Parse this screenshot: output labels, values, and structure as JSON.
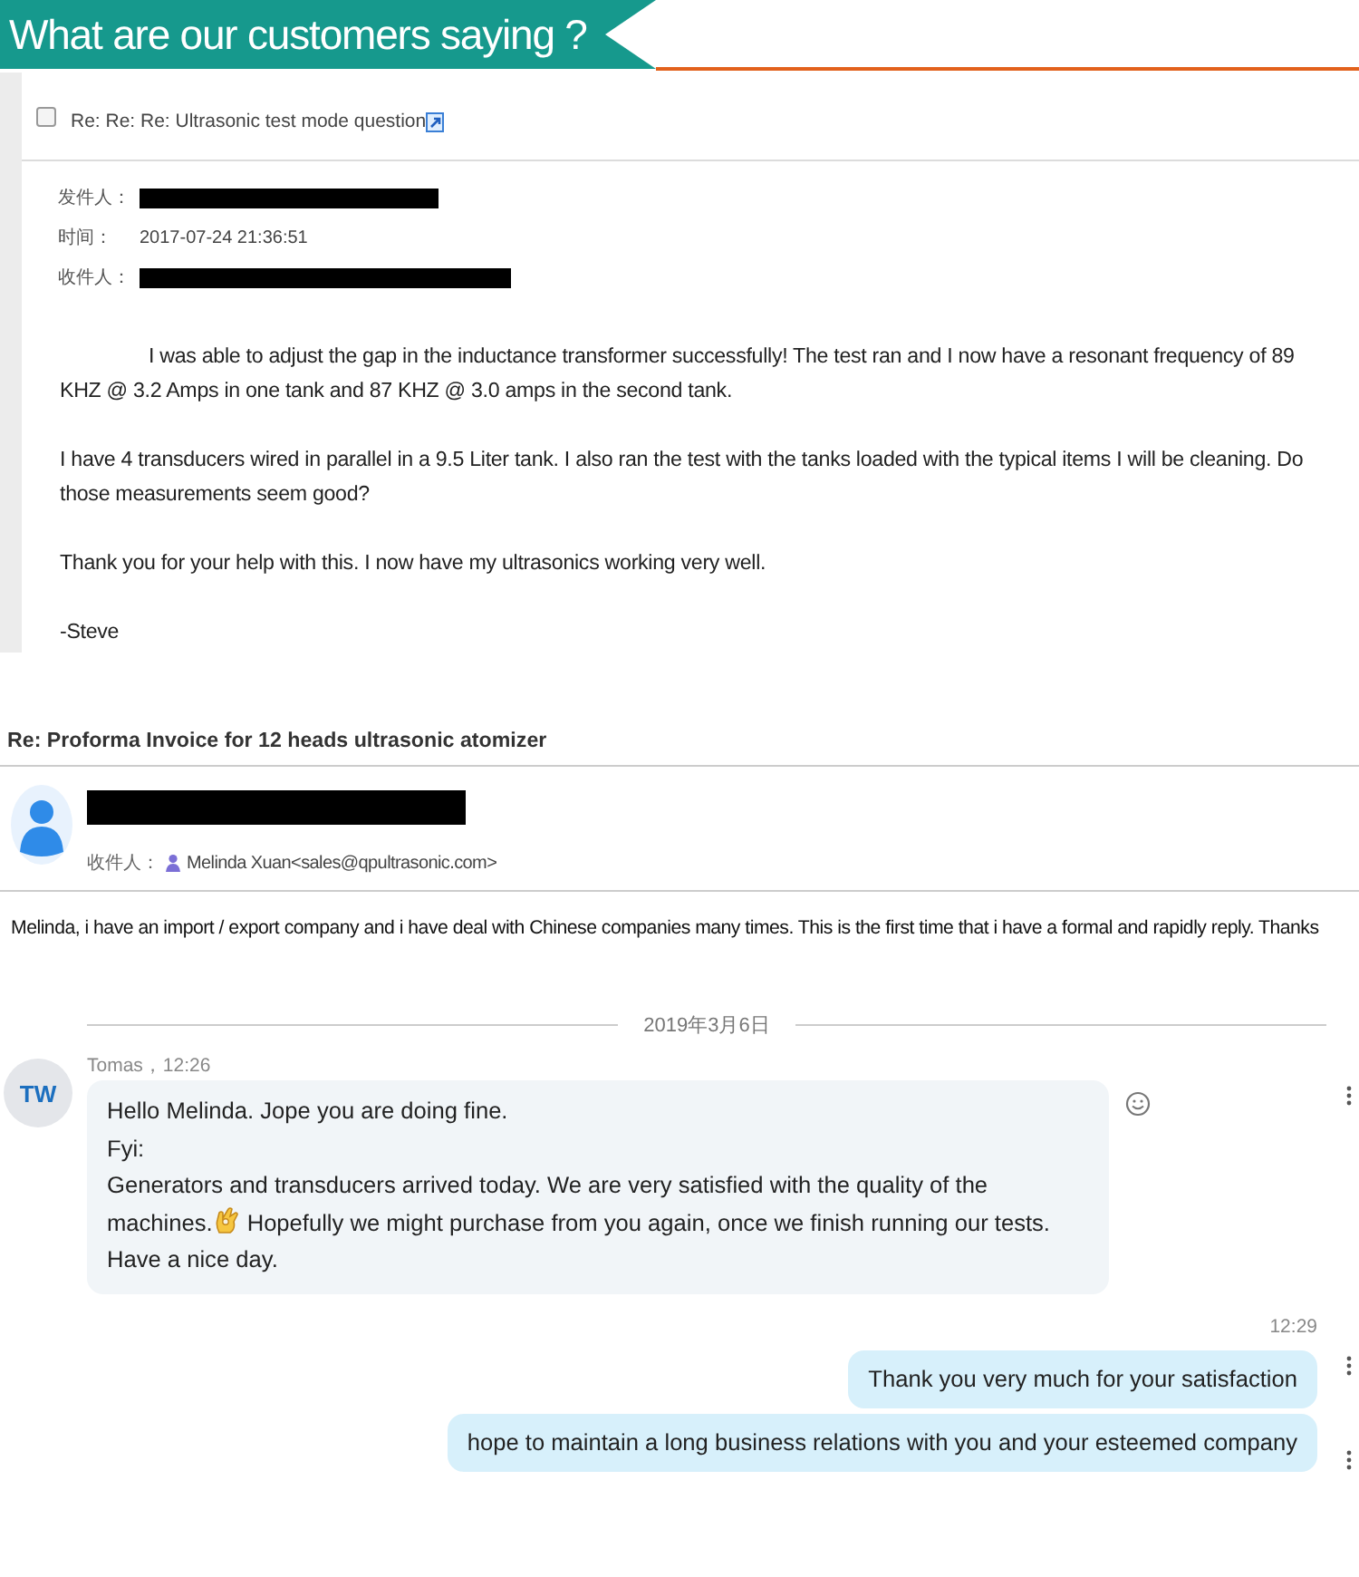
{
  "banner": {
    "title": "What are our customers saying ?"
  },
  "email_1": {
    "subject": "Re: Re: Re: Ultrasonic test mode question",
    "checked": false,
    "fields": [
      {
        "label": "发件人：",
        "redacted": true
      },
      {
        "label": "时间：",
        "redacted": false,
        "value": "2017-07-24 21:36:51"
      },
      {
        "label": "收件人：",
        "redacted": true
      }
    ],
    "paragraphs": [
      {
        "indent": true,
        "text": "I was able to adjust the gap in the inductance transformer successfully! The test ran and I now have a resonant frequency of 89 KHZ @ 3.2 Amps in one tank and 87 KHZ @ 3.0 amps in the second tank."
      },
      {
        "indent": false,
        "text": "I have 4 transducers wired in parallel in a 9.5 Liter tank. I also ran the test with the tanks loaded with the typical items I will be cleaning. Do those measurements seem good?"
      },
      {
        "indent": false,
        "text": "Thank you for your help with this. I now have my ultrasonics working very well."
      },
      {
        "indent": false,
        "text": "-Steve"
      }
    ]
  },
  "email_2": {
    "subject": "Re: Proforma Invoice for 12 heads ultrasonic atomizer",
    "sender_redacted": true,
    "recipient_label": "收件人：",
    "recipient": "Melinda Xuan<sales@qpultrasonic.com>",
    "body": "Melinda, i have an import / export company and i have deal with Chinese companies many times. This is the first time that i have a formal and rapidly reply. Thanks"
  },
  "chat": {
    "date": "2019年3月6日",
    "messages": [
      {
        "kind": "incoming",
        "avatar": "TW",
        "author": "Tomas，12:26",
        "lines": [
          {
            "text": "Hello Melinda. Jope you are doing fine.",
            "emoji": false
          },
          {
            "text": "Fyi:",
            "emoji": false
          },
          {
            "text": "Generators and transducers arrived today. We are very satisfied with the quality of the",
            "emoji": false
          },
          {
            "text": "machines.",
            "emoji": true,
            "after": "Hopefully we might purchase from you again, once we finish running our tests."
          },
          {
            "text": "Have a nice day.",
            "emoji": false
          }
        ]
      },
      {
        "kind": "outgoing",
        "time": "12:29",
        "text": "Thank you very much for your satisfaction"
      },
      {
        "kind": "outgoing",
        "text": "hope to maintain a long business relations with you and your esteemed company"
      }
    ]
  }
}
